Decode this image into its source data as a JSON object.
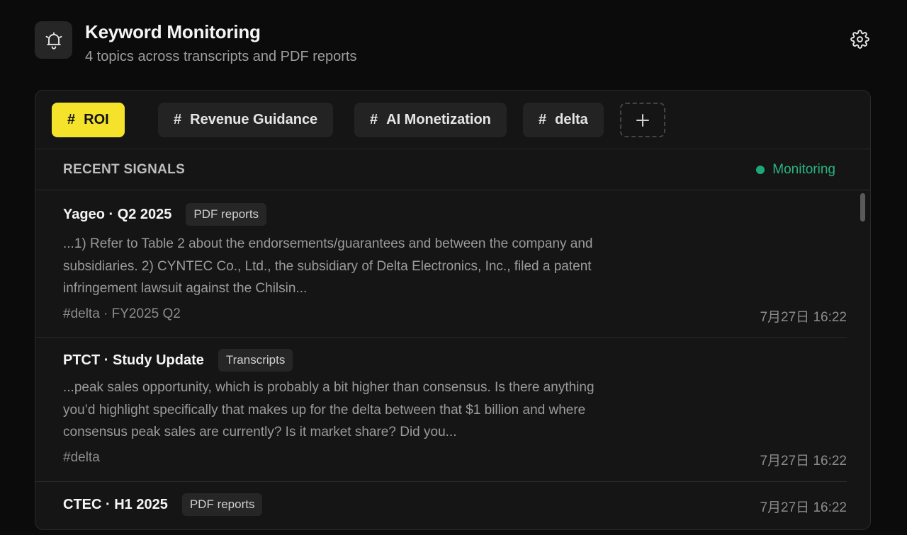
{
  "header": {
    "icon": "bell-icon",
    "title": "Keyword Monitoring",
    "subtitle": "4 topics across transcripts and PDF reports",
    "settings_icon": "gear-icon"
  },
  "tabs": [
    {
      "hash": "#",
      "label": "ROI",
      "active": true
    },
    {
      "hash": "#",
      "label": "Revenue Guidance",
      "active": false
    },
    {
      "hash": "#",
      "label": "AI Monetization",
      "active": false
    },
    {
      "hash": "#",
      "label": "delta",
      "active": false
    }
  ],
  "add_tab_icon": "plus-icon",
  "signals": {
    "title": "RECENT SIGNALS",
    "status": "Monitoring",
    "status_color": "#1fa877"
  },
  "items": [
    {
      "title": "Yageo · Q2 2025",
      "badge": "PDF reports",
      "snippet": "...1) Refer to Table 2 about the endorsements/guarantees and between the company and subsidiaries. 2) CYNTEC Co., Ltd., the subsidiary of Delta Electronics, Inc., filed a patent infringement lawsuit against the Chilsin...",
      "tags": "#delta · FY2025 Q2",
      "time": "7月27日 16:22"
    },
    {
      "title": "PTCT · Study Update",
      "badge": "Transcripts",
      "snippet": "...peak sales opportunity, which is probably a bit higher than consensus. Is there anything you’d highlight specifically that makes up for the delta between that $1 billion and where consensus peak sales are currently? Is it market share? Did you...",
      "tags": "#delta",
      "time": "7月27日 16:22"
    },
    {
      "title": "CTEC · H1 2025",
      "badge": "PDF reports",
      "time": "7月27日 16:22"
    }
  ],
  "colors": {
    "accent": "#f5e32b",
    "background": "#0b0b0b",
    "panel": "#151515"
  }
}
